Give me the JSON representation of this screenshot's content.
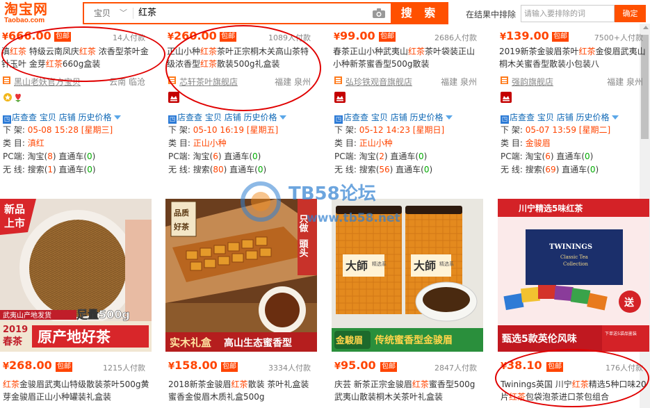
{
  "header": {
    "logo_cn": "淘宝网",
    "logo_en": "Taobao.com",
    "search_scope": "宝贝",
    "search_query": "红茶",
    "search_button": "搜 索",
    "exclude_label": "在结果中排除",
    "exclude_placeholder": "请输入要排除的词",
    "exclude_button": "确定"
  },
  "top_cards": [
    {
      "price": "666.00",
      "tag": "包邮",
      "paid": "14人付款",
      "title_parts": [
        "滇",
        "红茶",
        " 特级云南凤庆",
        "红茶",
        " 浓香型茶叶金针玉叶 金芽",
        "红茶",
        "660g盒装"
      ],
      "shop": "黑山老妖官方宝贝",
      "location": "云南 临沧",
      "tools": [
        "店查查",
        "宝贝",
        "店铺",
        "历史价格"
      ],
      "shelf_label": "下 架:",
      "shelf_date": "05-08 15:28",
      "shelf_week": "[星期三]",
      "cat_label": "类 目:",
      "category": "滇红",
      "pc_label": "PC端:",
      "pc_tb": "淘宝(",
      "pc_tb_n": "8",
      "pc_through": ")  直通车(",
      "pc_through_n": "0",
      "pc_end": ")",
      "wl_label": "无 线:",
      "wl_search": "搜索(",
      "wl_search_n": "1",
      "wl_through": ")  直通车(",
      "wl_through_n": "0",
      "wl_end": ")"
    },
    {
      "price": "260.00",
      "tag": "包邮",
      "paid": "1089人付款",
      "title_parts": [
        "正山小种",
        "红茶",
        "茶叶正宗桐木关高山茶特级浓香型",
        "红茶",
        "散装500g礼盒装"
      ],
      "shop": "芯轩茶叶旗舰店",
      "location": "福建 泉州",
      "tools": [
        "店查查",
        "宝贝",
        "店铺",
        "历史价格"
      ],
      "shelf_label": "下 架:",
      "shelf_date": "05-10 16:19",
      "shelf_week": "[星期五]",
      "cat_label": "类 目:",
      "category": "正山小种",
      "pc_label": "PC端:",
      "pc_tb": "淘宝(",
      "pc_tb_n": "6",
      "pc_through": ")  直通车(",
      "pc_through_n": "0",
      "pc_end": ")",
      "wl_label": "无 线:",
      "wl_search": "搜索(",
      "wl_search_n": "80",
      "wl_through": ")  直通车(",
      "wl_through_n": "0",
      "wl_end": ")"
    },
    {
      "price": "99.00",
      "tag": "包邮",
      "paid": "2686人付款",
      "title_parts": [
        "春茶正山小种武夷山",
        "红茶",
        "茶叶袋装正山小种新茶蜜香型500g散装"
      ],
      "shop": "弘珍铁观音旗舰店",
      "location": "福建 泉州",
      "tools": [
        "店查查",
        "宝贝",
        "店铺",
        "历史价格"
      ],
      "shelf_label": "下 架:",
      "shelf_date": "05-12 14:23",
      "shelf_week": "[星期日]",
      "cat_label": "类 目:",
      "category": "正山小种",
      "pc_label": "PC端:",
      "pc_tb": "淘宝(",
      "pc_tb_n": "2",
      "pc_through": ")  直通车(",
      "pc_through_n": "0",
      "pc_end": ")",
      "wl_label": "无 线:",
      "wl_search": "搜索(",
      "wl_search_n": "56",
      "wl_through": ")  直通车(",
      "wl_through_n": "0",
      "wl_end": ")"
    },
    {
      "price": "139.00",
      "tag": "包邮",
      "paid": "7500+人付款",
      "title_parts": [
        "2019新茶金骏眉茶叶",
        "红茶",
        "金俊眉武夷山桐木关蜜香型散装小包装八"
      ],
      "shop": "强韵旗舰店",
      "location": "福建 泉州",
      "tools": [
        "店查查",
        "宝贝",
        "店铺",
        "历史价格"
      ],
      "shelf_label": "下 架:",
      "shelf_date": "05-07 13:59",
      "shelf_week": "[星期二]",
      "cat_label": "类 目:",
      "category": "金骏眉",
      "pc_label": "PC端:",
      "pc_tb": "淘宝(",
      "pc_tb_n": "6",
      "pc_through": ")  直通车(",
      "pc_through_n": "0",
      "pc_end": ")",
      "wl_label": "无 线:",
      "wl_search": "搜索(",
      "wl_search_n": "69",
      "wl_through": ")  直通车(",
      "wl_through_n": "0",
      "wl_end": ")"
    }
  ],
  "bottom_cards": [
    {
      "price": "268.00",
      "tag": "包邮",
      "paid": "1215人付款",
      "title_parts": [
        "红茶",
        "金骏眉武夷山特级散装茶叶500g黄芽金骏眉正山小种罐装礼盒装"
      ],
      "img_text": [
        "新品",
        "上市",
        "武夷山产地发货",
        "足量500g",
        "2019",
        "春茶",
        "原产地好茶"
      ]
    },
    {
      "price": "158.00",
      "tag": "包邮",
      "paid": "3334人付款",
      "title_parts": [
        "2018新茶金骏眉",
        "红茶",
        "散装 茶叶礼盒装蜜香金俊眉木质礼盒500g"
      ],
      "img_text": [
        "品质",
        "好茶",
        "只做",
        "頭头",
        "香",
        "实木礼盒",
        "高山生态蜜香型"
      ]
    },
    {
      "price": "95.00",
      "tag": "包邮",
      "paid": "2847人付款",
      "title_parts": [
        "庆芸 新茶正宗金骏眉",
        "红茶",
        "蜜香型500g武夷山散装桐木关茶叶礼盒装"
      ],
      "img_text": [
        "大師",
        "精选系",
        "大師",
        "精选系",
        "金駿眉",
        "传统蜜香型金骏眉"
      ]
    },
    {
      "price": "38.10",
      "tag": "包邮",
      "paid": "176人付款",
      "title_parts": [
        "Twinings英国 川宁",
        "红茶",
        "精选5种口味20片",
        "红茶",
        "包袋泡茶进口茶包组合"
      ],
      "img_text": [
        "川宁精选5味红茶",
        "TWININGS",
        "Classic Tea",
        "Collection",
        "送",
        "甄选5款英伦风味",
        "下单送5袋品鉴装"
      ]
    }
  ],
  "watermark": {
    "name": "TB58论坛",
    "url": "www.tb58.net"
  },
  "colors": {
    "accent": "#ff5000",
    "price": "#ff4400",
    "link": "#0f68b6",
    "annotation": "#e00000"
  }
}
